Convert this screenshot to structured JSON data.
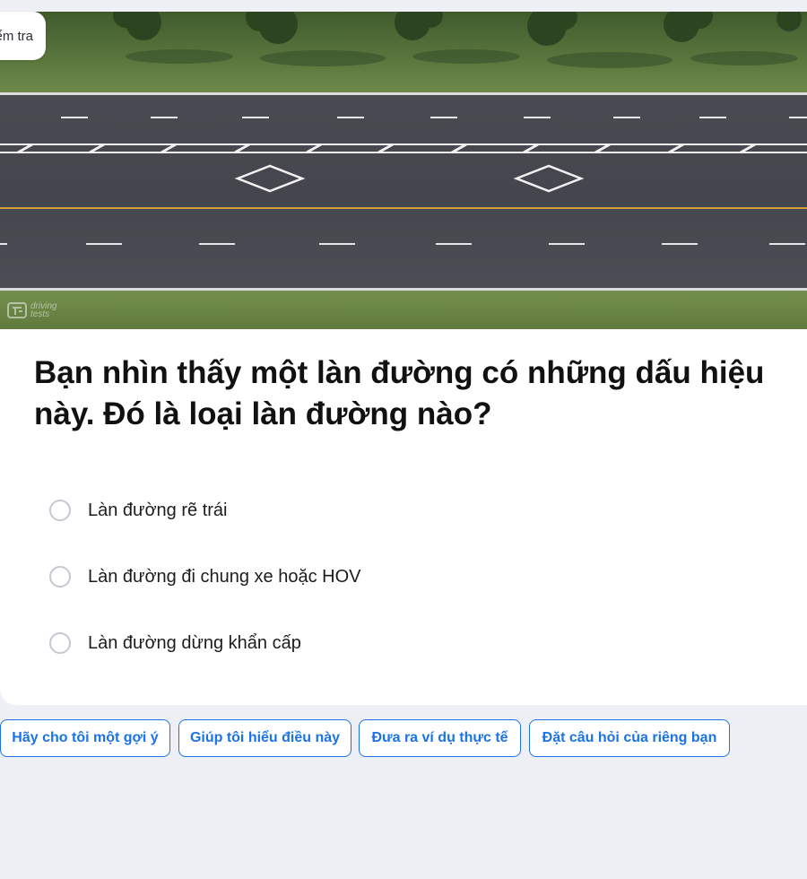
{
  "top_tab": {
    "label": "Kiểm tra"
  },
  "image": {
    "watermark_line1": "driving",
    "watermark_line2": "tests"
  },
  "question": {
    "text": "Bạn nhìn thấy một làn đường có những dấu hiệu này. Đó là loại làn đường nào?"
  },
  "options": [
    {
      "label": "Làn đường rẽ trái",
      "selected": false
    },
    {
      "label": "Làn đường đi chung xe hoặc HOV",
      "selected": false
    },
    {
      "label": "Làn đường dừng khẩn cấp",
      "selected": false
    }
  ],
  "suggestions": [
    {
      "label": "Hãy cho tôi một gợi ý"
    },
    {
      "label": "Giúp tôi hiểu điều này"
    },
    {
      "label": "Đưa ra ví dụ thực tế"
    },
    {
      "label": "Đặt câu hỏi của riêng bạn"
    }
  ],
  "colors": {
    "accent": "#1a73e8",
    "page_background": "#eff0f5",
    "radio_border": "#c5c8d2"
  }
}
